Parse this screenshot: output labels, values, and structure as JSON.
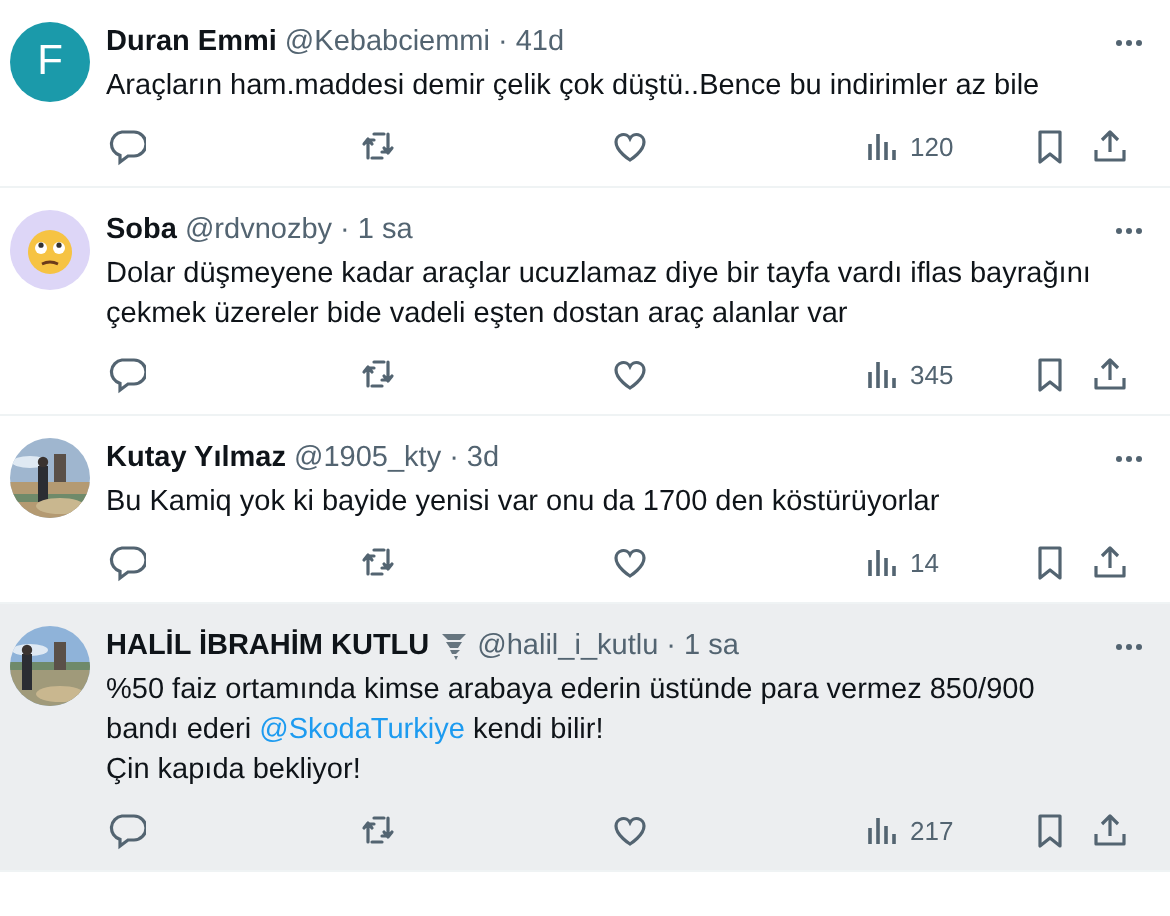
{
  "tweets": [
    {
      "name": "Duran Emmi",
      "handle": "@Kebabciemmi",
      "separator": "·",
      "time": "41d",
      "avatar": {
        "kind": "letter",
        "letter": "F",
        "color": "#1b9aaa"
      },
      "badge": false,
      "highlighted": false,
      "body": [
        [
          {
            "kind": "text",
            "text": "Araçların ham.maddesi demir çelik çok düştü..Bence bu indirimler az bile"
          }
        ]
      ],
      "views": "120"
    },
    {
      "name": "Soba",
      "handle": "@rdvnozby",
      "separator": "·",
      "time": "1 sa",
      "avatar": {
        "kind": "emoji",
        "color": "#ddd6f7"
      },
      "badge": false,
      "highlighted": false,
      "body": [
        [
          {
            "kind": "text",
            "text": "Dolar düşmeyene kadar araçlar ucuzlamaz diye bir tayfa vardı iflas bayrağını"
          }
        ],
        [
          {
            "kind": "text",
            "text": "çekmek üzereler bide vadeli eşten dostan araç alanlar var"
          }
        ]
      ],
      "views": "345"
    },
    {
      "name": "Kutay Yılmaz",
      "handle": "@1905_kty",
      "separator": "·",
      "time": "3d",
      "avatar": {
        "kind": "picture"
      },
      "badge": false,
      "highlighted": false,
      "body": [
        [
          {
            "kind": "text",
            "text": "Bu Kamiq yok ki bayide yenisi var onu da 1700 den köstürüyorlar"
          }
        ]
      ],
      "views": "14"
    },
    {
      "name": "HALİL İBRAHİM KUTLU",
      "handle": "@halil_i_kutlu",
      "separator": "·",
      "time": "1 sa",
      "avatar": {
        "kind": "picture"
      },
      "badge": true,
      "highlighted": true,
      "body": [
        [
          {
            "kind": "text",
            "text": "%50 faiz ortamında kimse arabaya ederin üstünde para vermez 850/900"
          }
        ],
        [
          {
            "kind": "text",
            "text": "bandı ederi "
          },
          {
            "kind": "link",
            "text": "@SkodaTurkiye"
          },
          {
            "kind": "text",
            "text": " kendi bilir!"
          }
        ],
        [
          {
            "kind": "text",
            "text": "Çin kapıda bekliyor!"
          }
        ]
      ],
      "views": "217"
    }
  ]
}
